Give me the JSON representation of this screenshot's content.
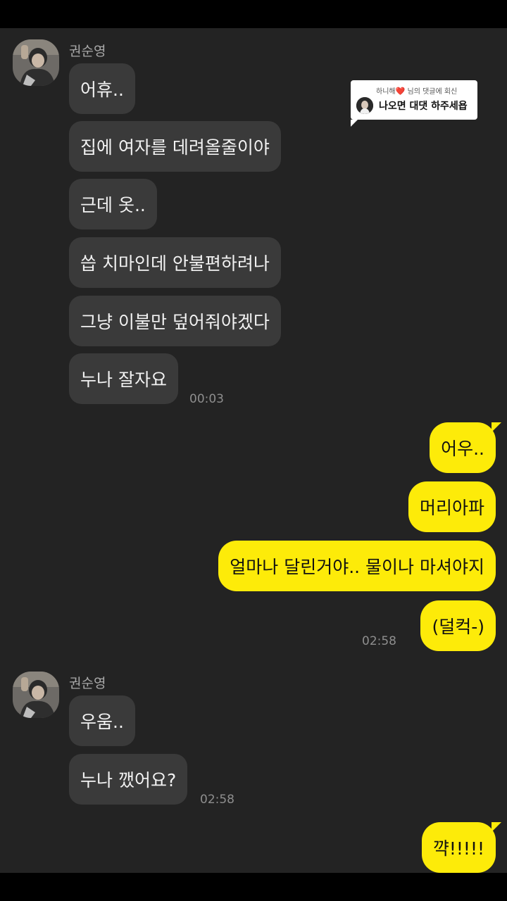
{
  "chat": {
    "group1": {
      "sender": "권순영",
      "messages": [
        "어휴..",
        "집에 여자를 데려올줄이야",
        "근데 옷..",
        "씁 치마인데 안불편하려나",
        "그냥 이불만 덮어줘야겠다",
        "누나 잘자요"
      ],
      "time": "00:03"
    },
    "group2": {
      "messages": [
        "어우..",
        "머리아파",
        "얼마나 달린거야.. 물이나 마셔야지",
        "(덜컥-)"
      ],
      "time": "02:58"
    },
    "group3": {
      "sender": "권순영",
      "messages": [
        "우움..",
        "누나 깼어요?"
      ],
      "time": "02:58"
    },
    "group4": {
      "messages": [
        "꺅!!!!!"
      ]
    }
  },
  "reply_notice": {
    "top_text_prefix": "하니해",
    "heart": "❤️",
    "top_text_suffix": "님의 댓글에 회신",
    "message": "나오면 대댓 하주세욥"
  },
  "colors": {
    "background": "#232323",
    "incoming_bubble": "#3a3a3a",
    "outgoing_bubble": "#fdeb09"
  },
  "icons": [
    "profile-avatar",
    "heart-icon"
  ]
}
